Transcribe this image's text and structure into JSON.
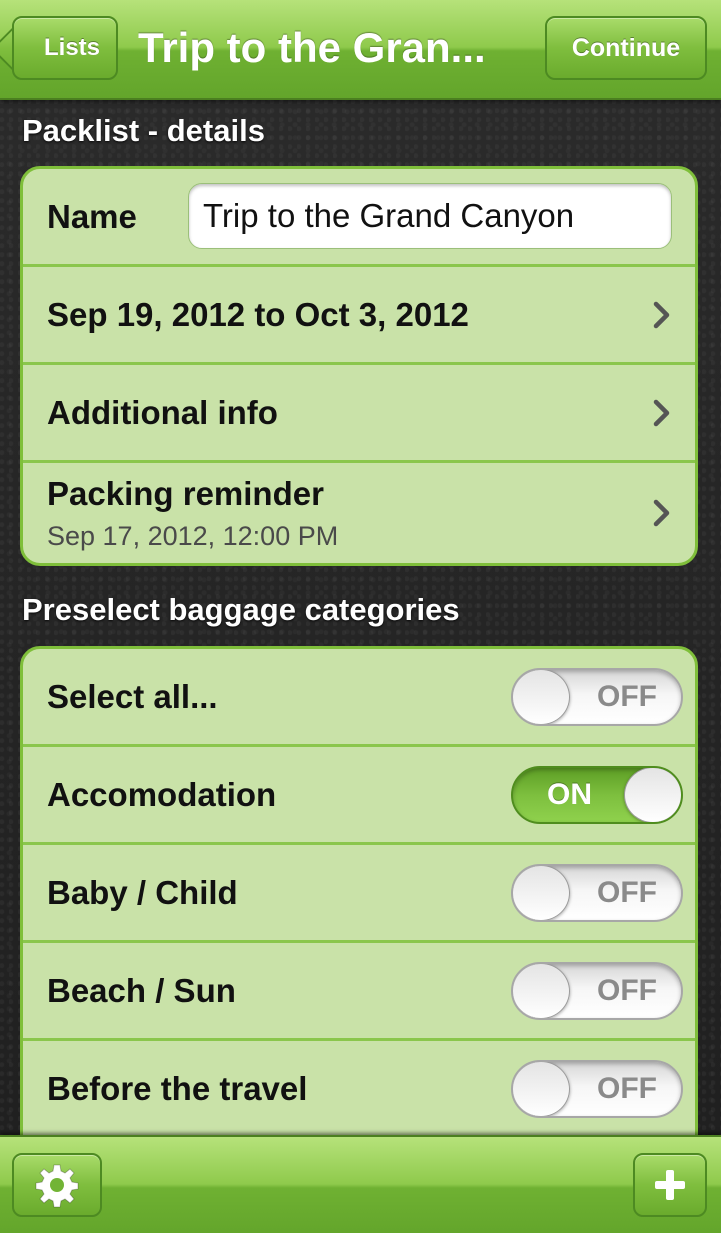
{
  "navbar": {
    "back_label": "Lists",
    "title": "Trip to the Gran...",
    "continue_label": "Continue"
  },
  "details": {
    "header": "Packlist - details",
    "name_label": "Name",
    "name_value": "Trip to the Grand Canyon",
    "date_range": "Sep 19, 2012 to Oct 3, 2012",
    "additional_info": "Additional info",
    "reminder_label": "Packing reminder",
    "reminder_value": "Sep 17, 2012, 12:00 PM"
  },
  "categories": {
    "header": "Preselect baggage categories",
    "items": [
      {
        "label": "Select all...",
        "state": "OFF"
      },
      {
        "label": "Accomodation",
        "state": "ON"
      },
      {
        "label": "Baby / Child",
        "state": "OFF"
      },
      {
        "label": "Beach / Sun",
        "state": "OFF"
      },
      {
        "label": "Before the travel",
        "state": "OFF"
      }
    ]
  },
  "toolbar": {
    "settings_icon": "gear-icon",
    "add_icon": "plus-icon"
  },
  "colors": {
    "accent_green": "#7fbe3e",
    "row_background": "#c9e2a8"
  }
}
